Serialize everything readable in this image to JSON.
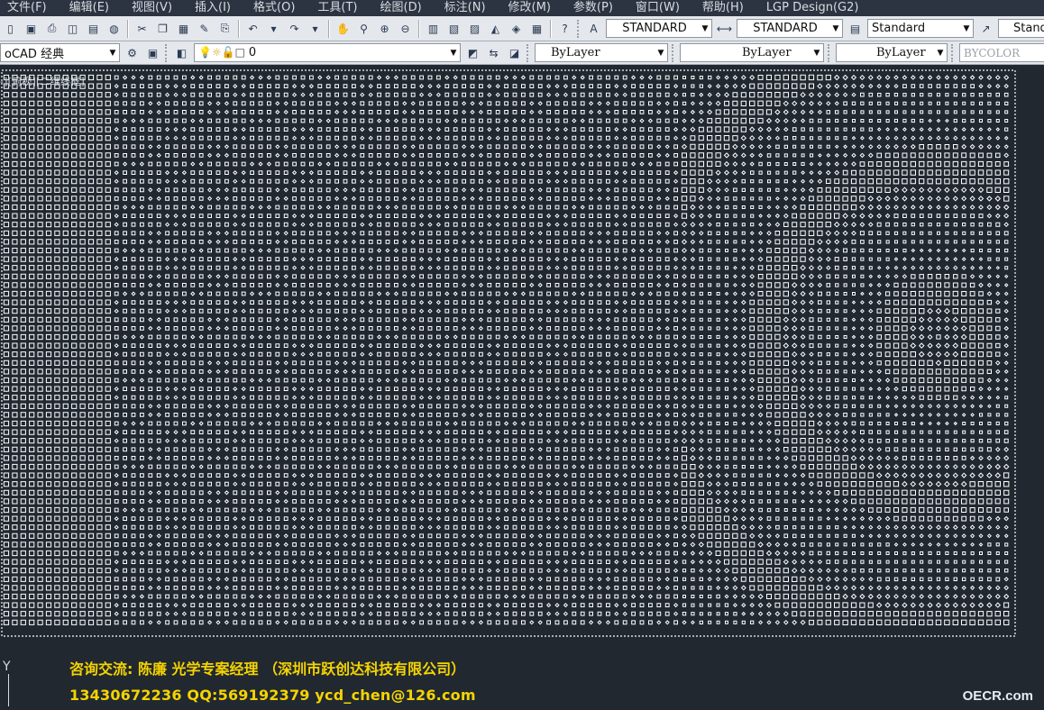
{
  "menu": [
    "文件(F)",
    "编辑(E)",
    "视图(V)",
    "插入(I)",
    "格式(O)",
    "工具(T)",
    "绘图(D)",
    "标注(N)",
    "修改(M)",
    "参数(P)",
    "窗口(W)",
    "帮助(H)",
    "LGP Design(G2)"
  ],
  "toolbar1": {
    "text_style": "STANDARD",
    "dim_style": "STANDARD",
    "table_style": "Standard",
    "multileader_style": "Standard"
  },
  "toolbar2": {
    "workspace": "oCAD 经典",
    "layer": "0",
    "color": "ByLayer",
    "linetype": "ByLayer",
    "lineweight": "ByLayer",
    "plotstyle": "BYCOLOR"
  },
  "viewport": {
    "label": "-][俯视][二维线框]",
    "ucs_axis": "Y"
  },
  "overlay": {
    "contact_line1": "咨询交流:  陈廉  光学专案经理   （深圳市跃创达科技有限公司）",
    "contact_line2": "13430672236   QQ:569192379  ycd_chen@126.com",
    "watermark": "OECR.com"
  },
  "colors": {
    "canvas": "#212830",
    "dots": "#ffffff",
    "contact_text": "#f5d400"
  }
}
